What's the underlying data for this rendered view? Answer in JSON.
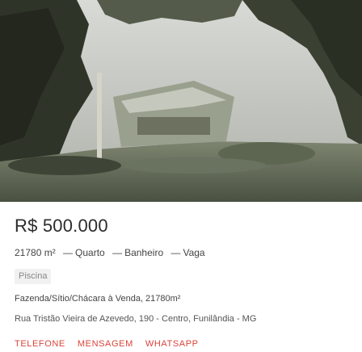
{
  "listing": {
    "photo_alt": "Fazenda photo",
    "price": "R$ 500.000",
    "specs": {
      "area": "21780 m²",
      "rooms": "Quarto",
      "bathrooms": "Banheiro",
      "parking": "Vaga",
      "separator": "—"
    },
    "feature_tag": "Piscina",
    "title": "Fazenda/Sítio/Chácara à Venda, 21780m²",
    "address": "Rua Tristão Vieira de Azevedo, 190 - Centro, Funilândia - MG"
  },
  "actions": {
    "phone_label": "TELEFONE",
    "message_label": "MENSAGEM",
    "whatsapp_label": "WHATSAPP"
  },
  "colors": {
    "accent": "#d9443a",
    "text": "#333333",
    "tag_bg": "#f1f1f1"
  }
}
